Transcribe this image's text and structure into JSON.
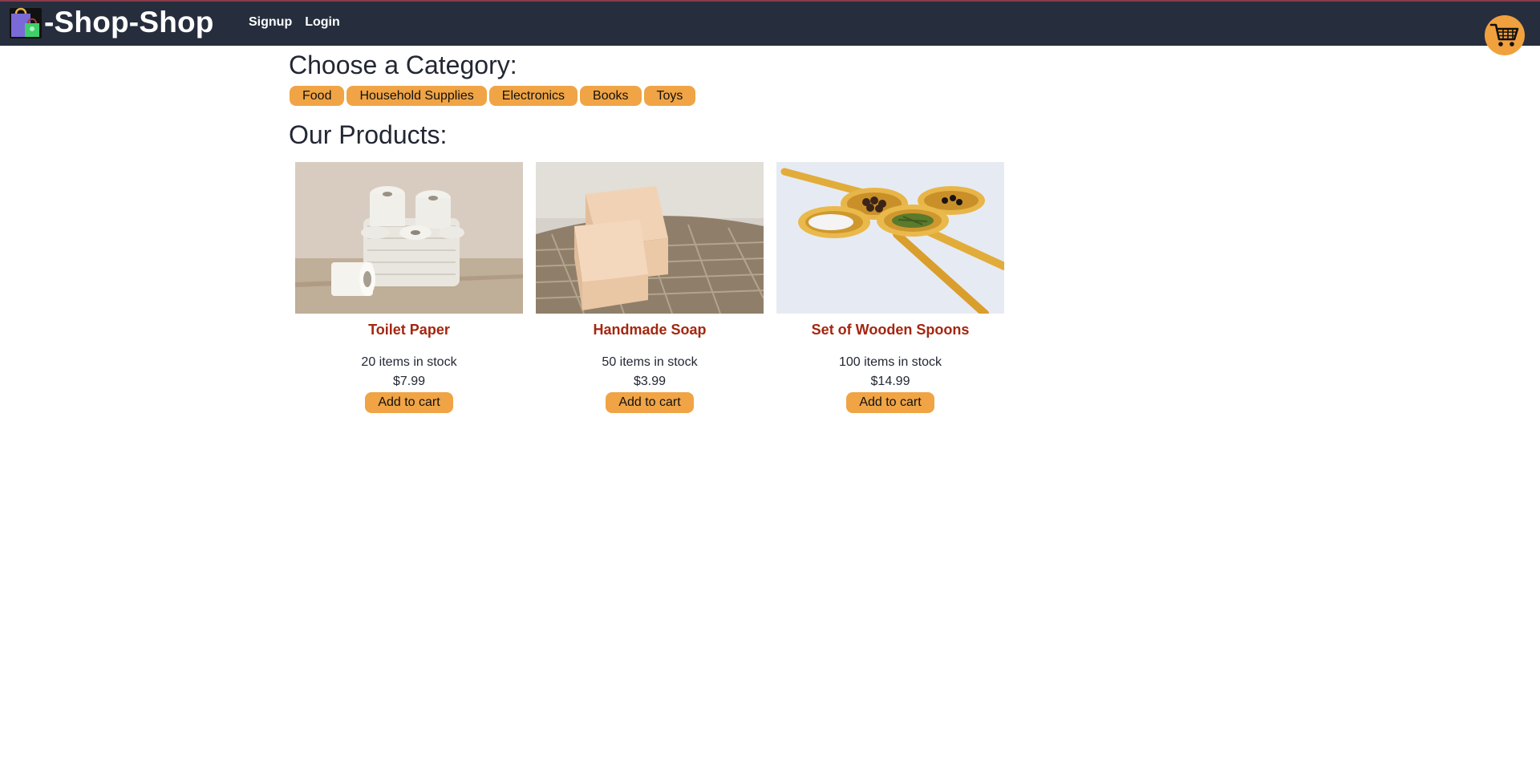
{
  "brand": {
    "name": "-Shop-Shop",
    "logo_icon": "shopping-bag-icon"
  },
  "nav": {
    "signup_label": "Signup",
    "login_label": "Login"
  },
  "cart": {
    "icon": "shopping-cart-icon"
  },
  "categories": {
    "title": "Choose a Category:",
    "items": [
      "Food",
      "Household Supplies",
      "Electronics",
      "Books",
      "Toys"
    ]
  },
  "products": {
    "title": "Our Products:",
    "items": [
      {
        "name": "Toilet Paper",
        "stock": "20 items in stock",
        "price": "$7.99",
        "button": "Add to cart",
        "image": "toilet-paper-photo"
      },
      {
        "name": "Handmade Soap",
        "stock": "50 items in stock",
        "price": "$3.99",
        "button": "Add to cart",
        "image": "handmade-soap-photo"
      },
      {
        "name": "Set of Wooden Spoons",
        "stock": "100 items in stock",
        "price": "$14.99",
        "button": "Add to cart",
        "image": "wooden-spoons-photo"
      }
    ]
  },
  "colors": {
    "navbar": "#262e3d",
    "accent": "#f0a445",
    "product_name": "#a4260f",
    "text": "#222733"
  }
}
